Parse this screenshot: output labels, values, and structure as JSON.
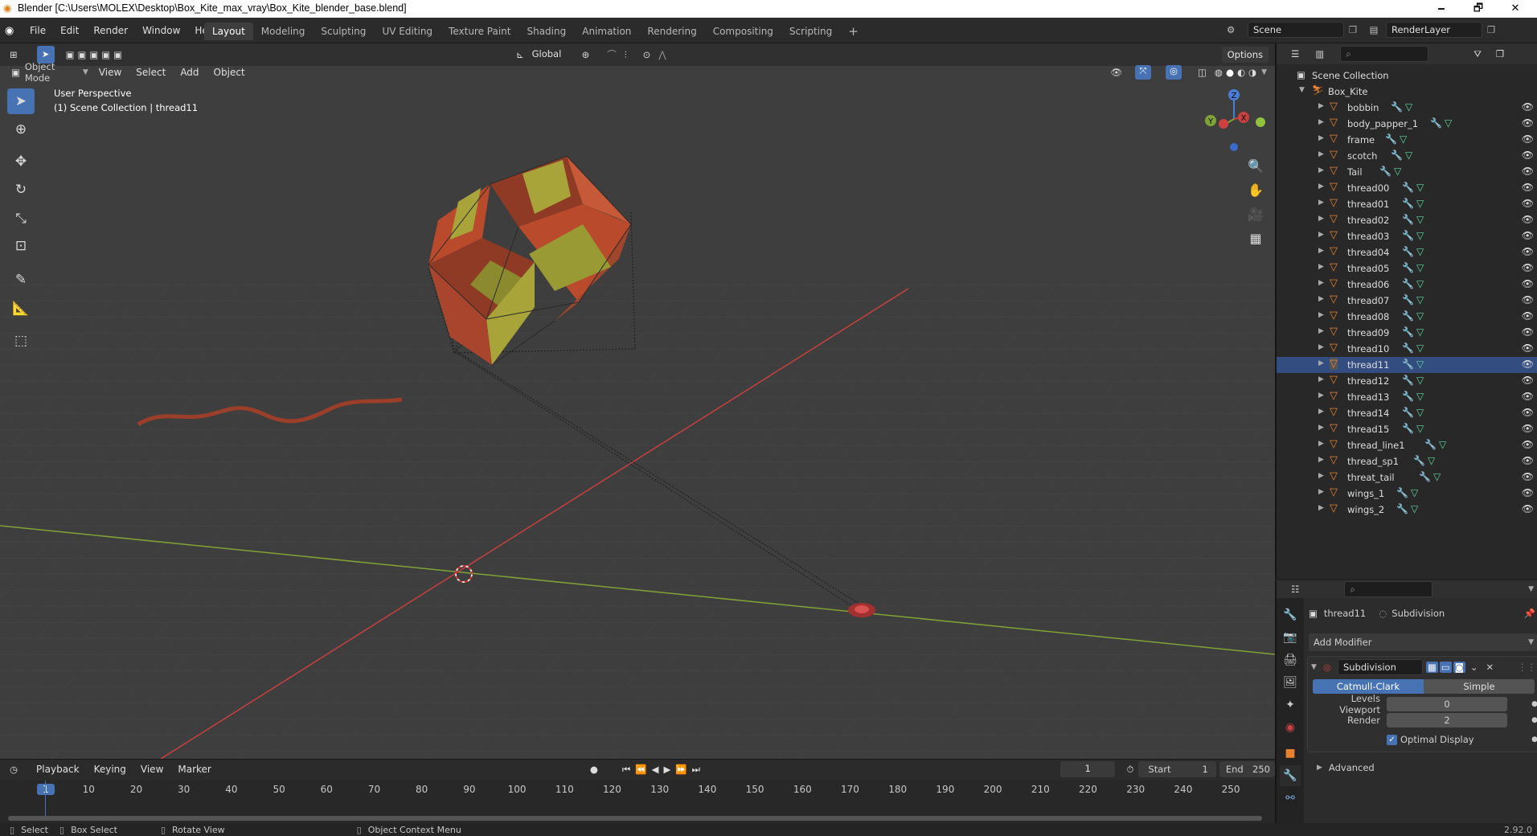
{
  "window": {
    "title": "Blender [C:\\Users\\MOLEX\\Desktop\\Box_Kite_max_vray\\Box_Kite_blender_base.blend]",
    "minimize": "🗕",
    "maximize": "🗗",
    "close": "✕"
  },
  "menus": [
    "File",
    "Edit",
    "Render",
    "Window",
    "Help"
  ],
  "workspaces": [
    "Layout",
    "Modeling",
    "Sculpting",
    "UV Editing",
    "Texture Paint",
    "Shading",
    "Animation",
    "Rendering",
    "Compositing",
    "Scripting"
  ],
  "workspace_add": "+",
  "scene": {
    "label": "Scene",
    "render_layer": "RenderLayer"
  },
  "view_toolbar": {
    "transform_orientation": "Global",
    "options": "Options"
  },
  "viewport_header": {
    "mode": "Object Mode",
    "menus": [
      "View",
      "Select",
      "Add",
      "Object"
    ]
  },
  "viewport": {
    "perspective": "User Perspective",
    "collection_info": "(1) Scene Collection | thread11",
    "gizmo": {
      "x": "X",
      "y": "Y",
      "z": "Z"
    }
  },
  "outliner": {
    "root": "Scene Collection",
    "collection": "Box_Kite",
    "selected": "thread11",
    "items": [
      "bobbin",
      "body_papper_1",
      "frame",
      "scotch",
      "Tail",
      "thread00",
      "thread01",
      "thread02",
      "thread03",
      "thread04",
      "thread05",
      "thread06",
      "thread07",
      "thread08",
      "thread09",
      "thread10",
      "thread11",
      "thread12",
      "thread13",
      "thread14",
      "thread15",
      "thread_line1",
      "thread_sp1",
      "threat_tail",
      "wings_1",
      "wings_2"
    ]
  },
  "properties": {
    "object": "thread11",
    "modifier_breadcrumb": "Subdivision",
    "add_modifier": "Add Modifier",
    "modifier_name": "Subdivision",
    "type_catmull": "Catmull-Clark",
    "type_simple": "Simple",
    "levels_viewport_label": "Levels Viewport",
    "levels_viewport": "0",
    "render_label": "Render",
    "render": "2",
    "optimal_display": "Optimal Display",
    "optimal_display_checked": true,
    "advanced": "Advanced"
  },
  "timeline": {
    "menus": [
      "Playback",
      "Keying",
      "View",
      "Marker"
    ],
    "current_frame": "1",
    "start_label": "Start",
    "start": "1",
    "end_label": "End",
    "end": "250",
    "ticks": [
      "1",
      "10",
      "20",
      "30",
      "40",
      "50",
      "60",
      "70",
      "80",
      "90",
      "100",
      "110",
      "120",
      "130",
      "140",
      "150",
      "160",
      "170",
      "180",
      "190",
      "200",
      "210",
      "220",
      "230",
      "240",
      "250"
    ]
  },
  "statusbar": {
    "select": "Select",
    "box_select": "Box Select",
    "rotate_view": "Rotate View",
    "context_menu": "Object Context Menu",
    "version": "2.92.0"
  },
  "colors": {
    "accent": "#4772b3",
    "mesh_icon": "#e8822f",
    "kite_red": "#b94a2c",
    "kite_yellow": "#a8a43a",
    "axis_x": "#c8403f",
    "axis_y": "#7fa335"
  }
}
